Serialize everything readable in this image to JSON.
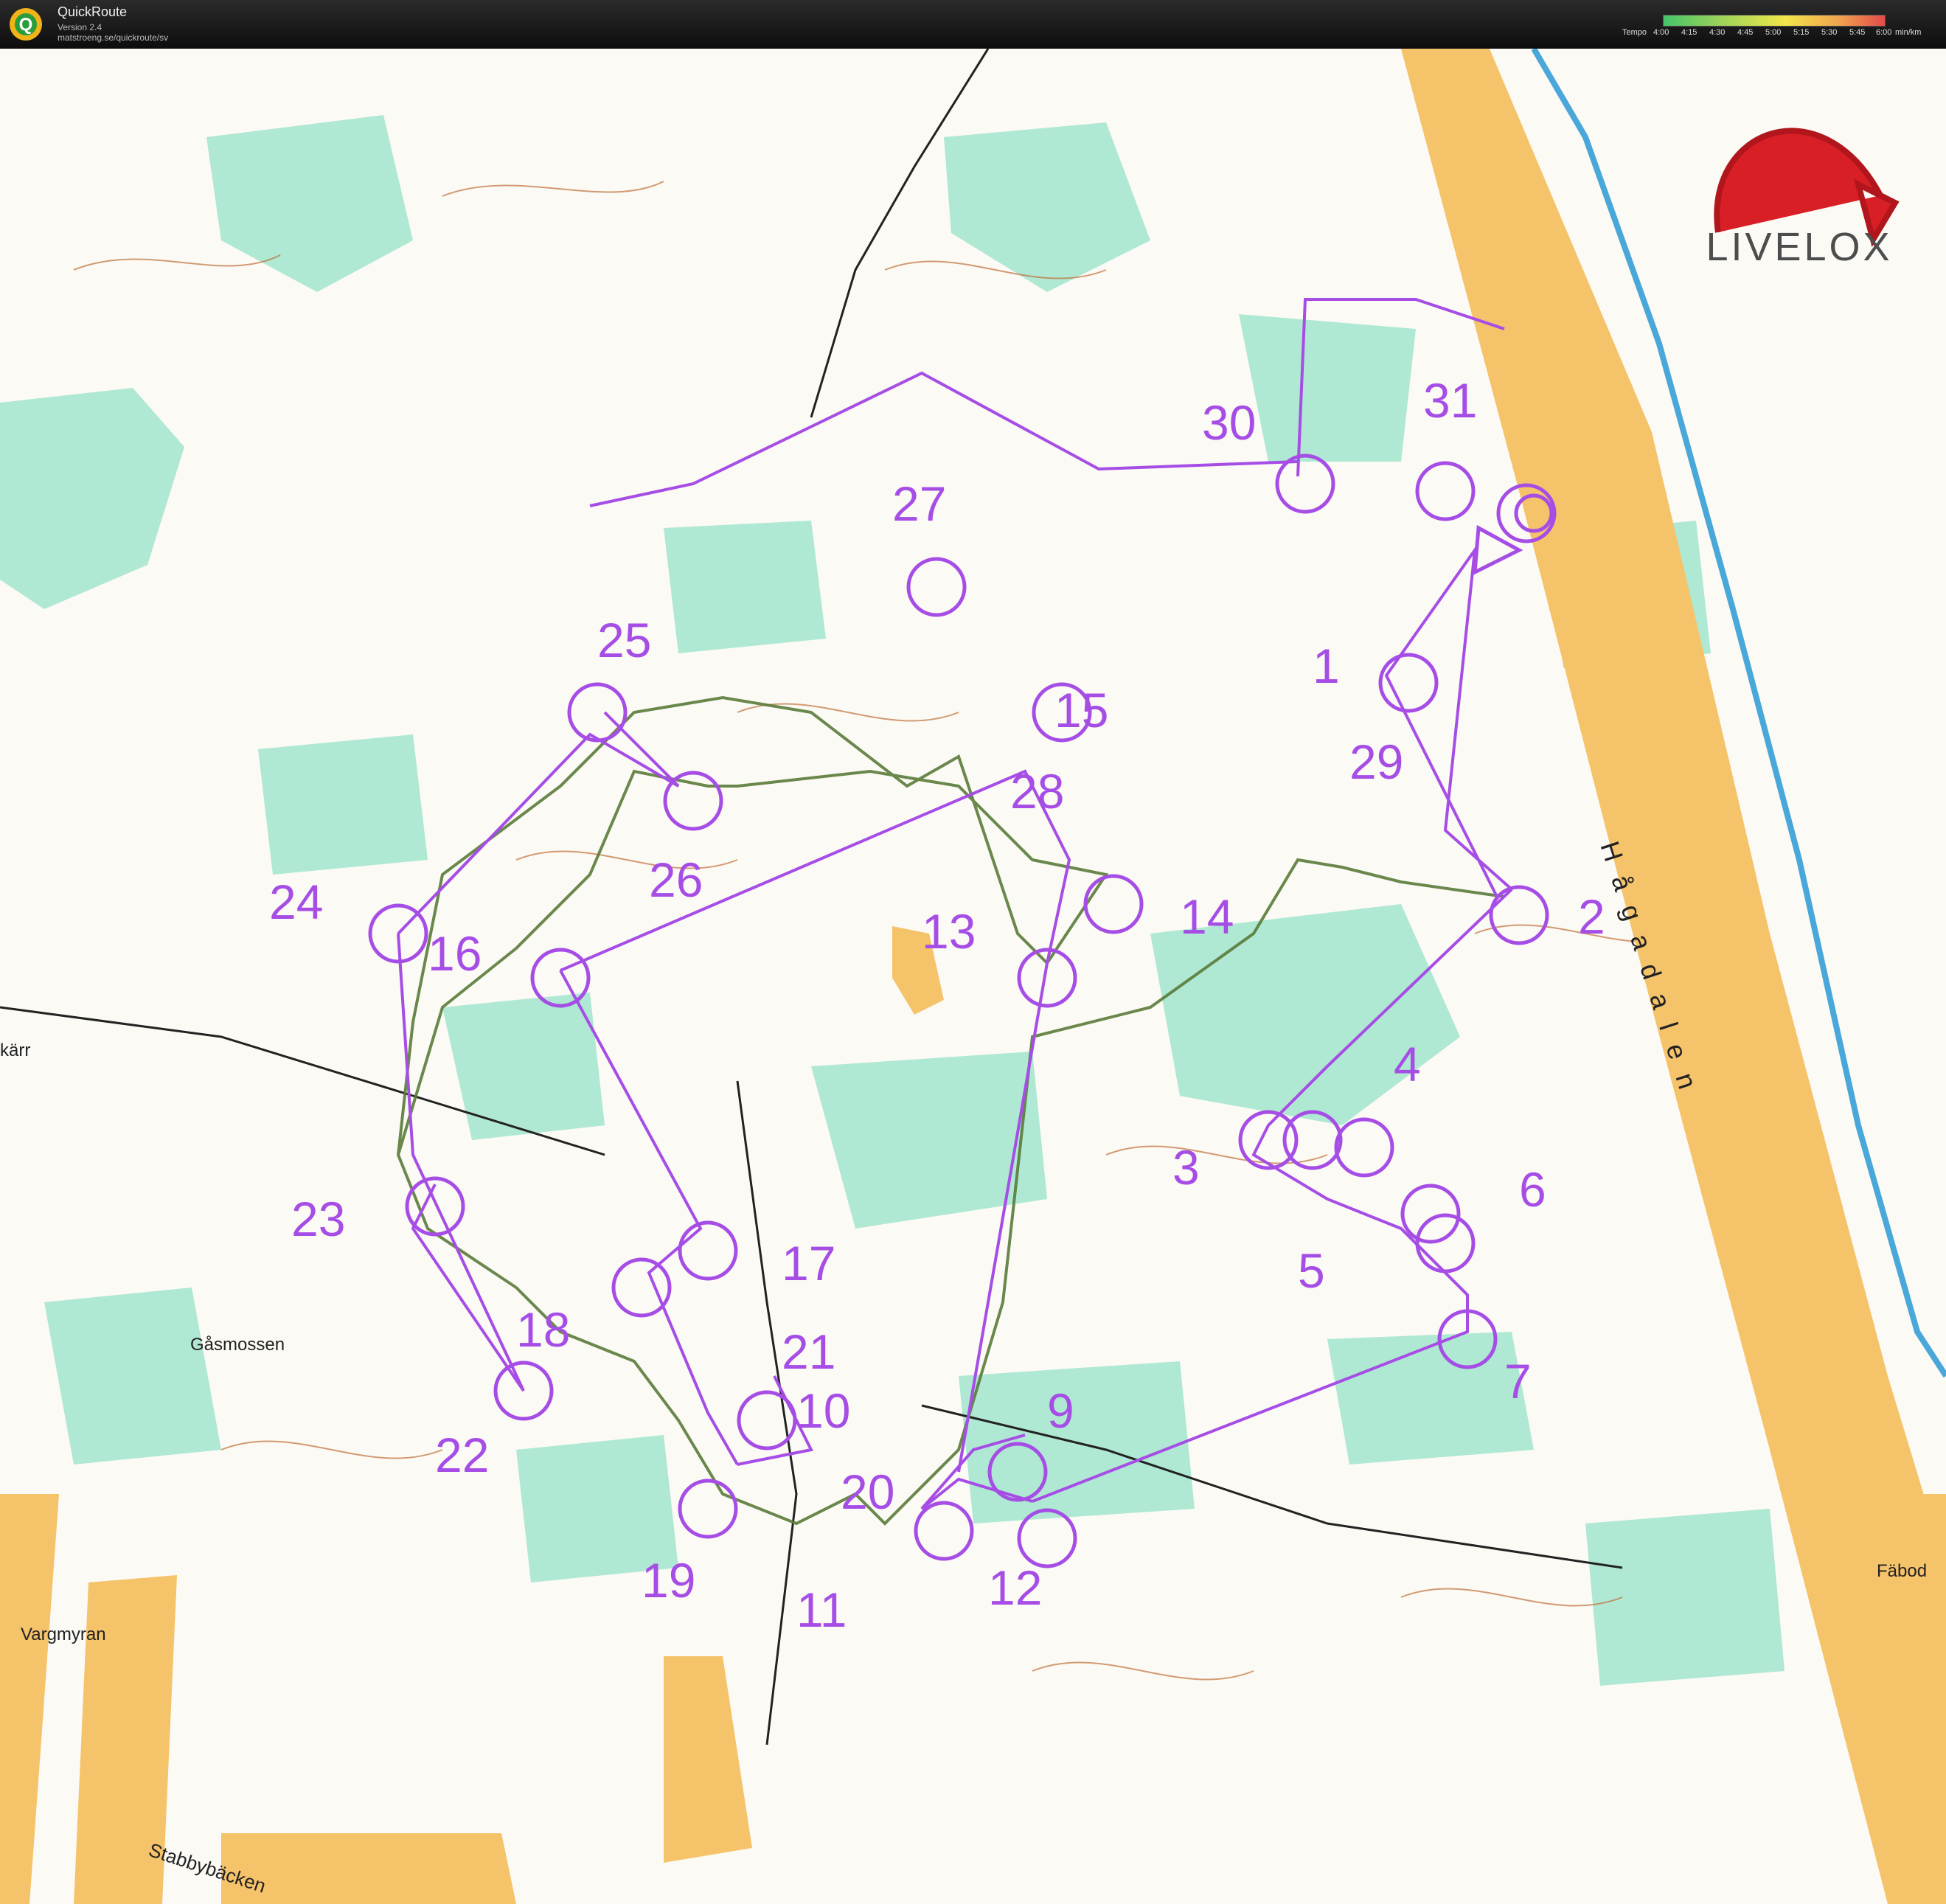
{
  "app": {
    "title": "QuickRoute",
    "version": "Version 2.4",
    "url": "matstroeng.se/quickroute/sv",
    "logo_letter": "Q"
  },
  "tempo": {
    "label": "Tempo",
    "ticks": [
      "4:00",
      "4:15",
      "4:30",
      "4:45",
      "5:00",
      "5:15",
      "5:30",
      "5:45",
      "6:00"
    ],
    "unit": "min/km"
  },
  "brand": {
    "name": "LIVELOX"
  },
  "place_names": [
    "Hågadalen",
    "Gåsmossen",
    "Vargmyran",
    "Stabbybäcken",
    "Fäbod",
    "kärr"
  ],
  "control_numbers": [
    "1",
    "2",
    "3",
    "4",
    "5",
    "6",
    "7",
    "9",
    "10",
    "11",
    "12",
    "13",
    "14",
    "15",
    "16",
    "17",
    "18",
    "19",
    "20",
    "21",
    "22",
    "23",
    "24",
    "25",
    "26",
    "27",
    "28",
    "29",
    "30",
    "31"
  ],
  "colors": {
    "course": "#a64de6",
    "route": "#5a7a3a",
    "forest": "#ffffff",
    "green": "#9fe5c9",
    "open": "#f5c36a",
    "contour": "#c0703a",
    "water": "#4aa7d9"
  }
}
